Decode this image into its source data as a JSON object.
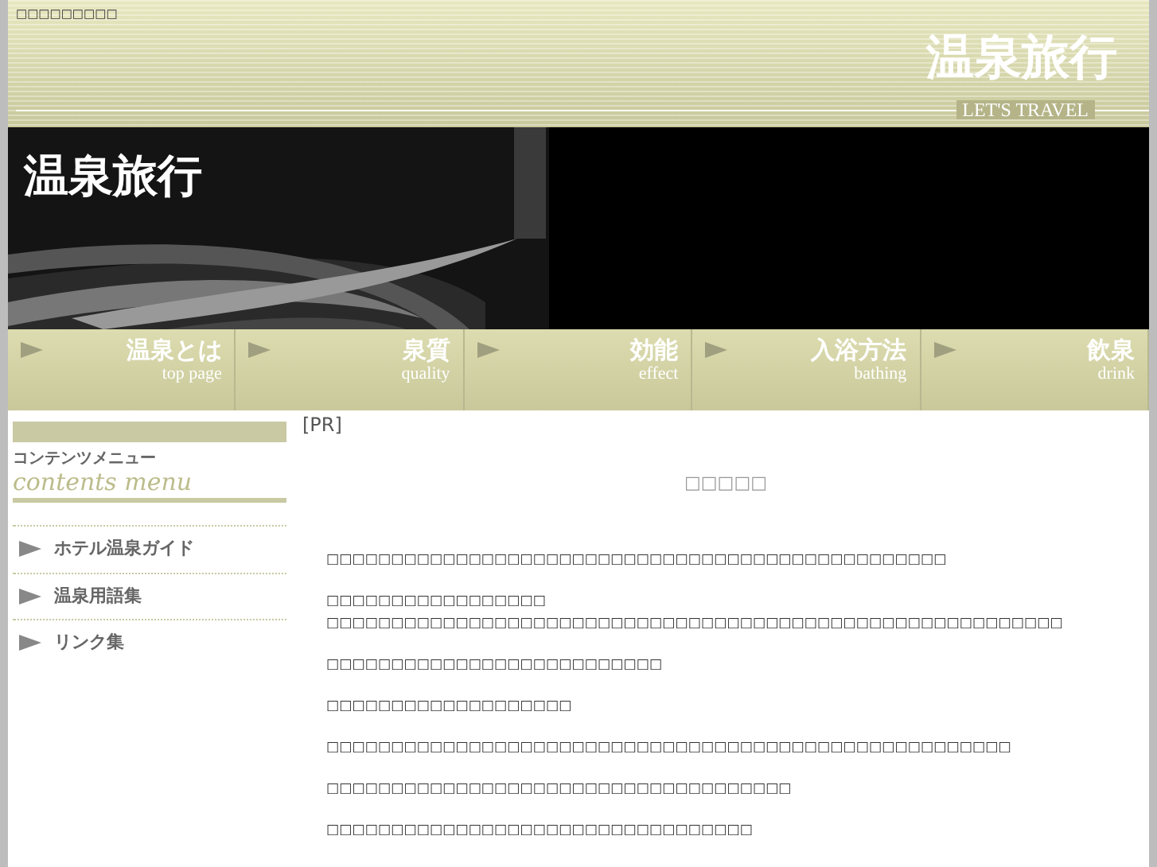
{
  "header": {
    "tagline": "□□□□□□□□□",
    "logo": "温泉旅行",
    "logo_sub": "LET'S TRAVEL"
  },
  "banner": {
    "title": "温泉旅行"
  },
  "nav": [
    {
      "label": "温泉とは",
      "sub": "top page"
    },
    {
      "label": "泉質",
      "sub": "quality"
    },
    {
      "label": "効能",
      "sub": "effect"
    },
    {
      "label": "入浴方法",
      "sub": "bathing"
    },
    {
      "label": "飲泉",
      "sub": "drink"
    }
  ],
  "sidebar": {
    "heading": "コンテンツメニュー",
    "heading_sub": "contents menu",
    "items": [
      "ホテル温泉ガイド",
      "温泉用語集",
      "リンク集"
    ]
  },
  "content": {
    "pr": "[PR]",
    "title": "□□□□□",
    "paragraphs": [
      [
        "□□□□□□□□□□□□□□□□□□□□□□□□□□□□□□□□□□□□□□□□□□□□□□□□"
      ],
      [
        "□□□□□□□□□□□□□□□□□",
        "□□□□□□□□□□□□□□□□□□□□□□□□□□□□□□□□□□□□□□□□□□□□□□□□□□□□□□□□□"
      ],
      [
        "□□□□□□□□□□□□□□□□□□□□□□□□□□"
      ],
      [
        "□□□□□□□□□□□□□□□□□□□"
      ],
      [
        "□□□□□□□□□□□□□□□□□□□□□□□□□□□□□□□□□□□□□□□□□□□□□□□□□□□□□"
      ],
      [
        "□□□□□□□□□□□□□□□□□□□□□□□□□□□□□□□□□□□□"
      ],
      [
        "□□□□□□□□□□□□□□□□□□□□□□□□□□□□□□□□□"
      ]
    ]
  }
}
